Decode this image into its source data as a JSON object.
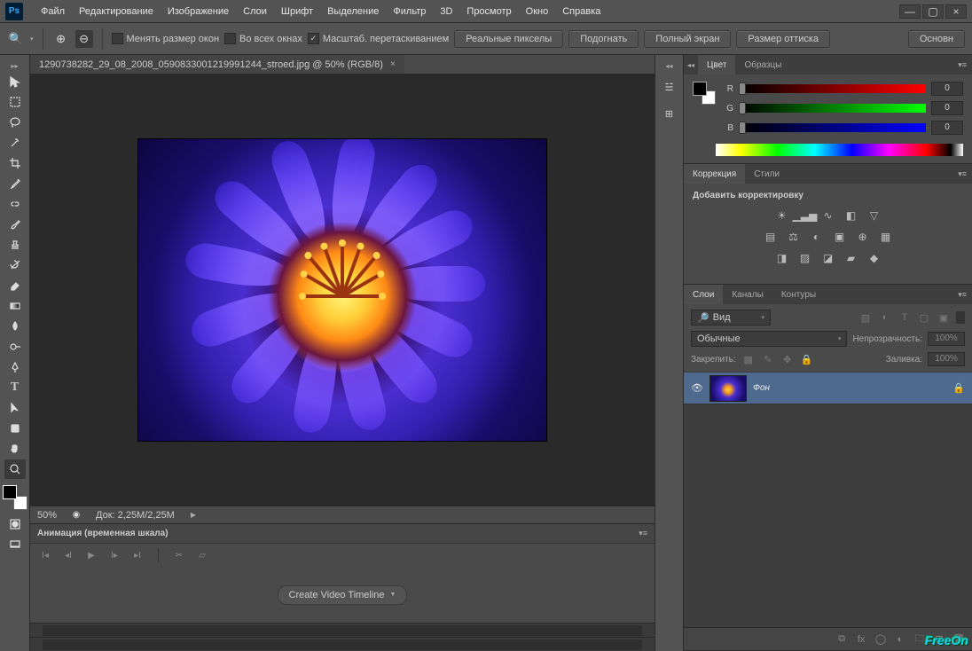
{
  "app": {
    "logo": "Ps"
  },
  "menu": [
    "Файл",
    "Редактирование",
    "Изображение",
    "Слои",
    "Шрифт",
    "Выделение",
    "Фильтр",
    "3D",
    "Просмотр",
    "Окно",
    "Справка"
  ],
  "window_controls": {
    "min": "—",
    "max": "▢",
    "close": "×"
  },
  "options": {
    "check1": "Менять размер окон",
    "check2": "Во всех окнах",
    "check3": "Масштаб. перетаскиванием",
    "check3_checked": "✓",
    "btn1": "Реальные пикселы",
    "btn2": "Подогнать",
    "btn3": "Полный экран",
    "btn4": "Размер оттиска",
    "btn_right": "Основн"
  },
  "doc": {
    "tab_title": "1290738282_29_08_2008_0590833001219991244_stroed.jpg @ 50% (RGB/8)",
    "tab_close": "×",
    "zoom": "50%",
    "doc_info": "Док: 2,25M/2,25M"
  },
  "timeline": {
    "title": "Анимация (временная шкала)",
    "create_btn": "Create Video Timeline"
  },
  "color": {
    "tab1": "Цвет",
    "tab2": "Образцы",
    "r_lbl": "R",
    "g_lbl": "G",
    "b_lbl": "B",
    "r_val": "0",
    "g_val": "0",
    "b_val": "0"
  },
  "adjust": {
    "tab1": "Коррекция",
    "tab2": "Стили",
    "heading": "Добавить корректировку"
  },
  "layers": {
    "tab1": "Слои",
    "tab2": "Каналы",
    "tab3": "Контуры",
    "filter_kind": "Вид",
    "blend": "Обычные",
    "opacity_lbl": "Непрозрачность:",
    "opacity_val": "100%",
    "lock_lbl": "Закрепить:",
    "fill_lbl": "Заливка:",
    "fill_val": "100%",
    "layer_name": "Фон"
  },
  "watermark": "FreeOn"
}
